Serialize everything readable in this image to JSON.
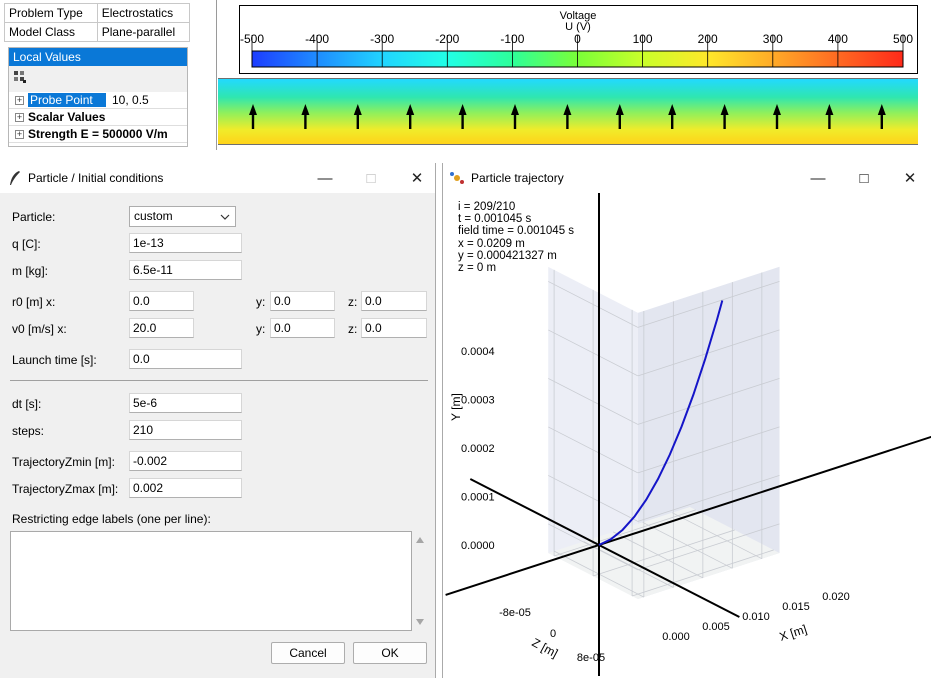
{
  "properties": [
    {
      "key": "Problem Type",
      "value": "Electrostatics"
    },
    {
      "key": "Model Class",
      "value": "Plane-parallel"
    }
  ],
  "local_values": {
    "title": "Local Values",
    "toolbar_icon": "grid-icon",
    "rows": [
      {
        "label": "Probe Point",
        "value": "10, 0.5"
      },
      {
        "label": "Scalar Values",
        "value": ""
      },
      {
        "label": "Strength E = 500000 V/m",
        "value": ""
      }
    ]
  },
  "colorbar": {
    "title": "Voltage",
    "subtitle": "U (V)",
    "ticks": [
      "-500",
      "-400",
      "-300",
      "-200",
      "-100",
      "0",
      "100",
      "200",
      "300",
      "400",
      "500"
    ],
    "colors": [
      "#1d3dff",
      "#1f8cff",
      "#21d4ff",
      "#22ffe6",
      "#2dff9a",
      "#7aff38",
      "#c9ff2a",
      "#ffe82a",
      "#ffab28",
      "#ff6a22",
      "#ff2a1a"
    ]
  },
  "field_strip": {
    "arrow_count": 13,
    "arrow_direction": "up"
  },
  "initial_conditions": {
    "title": "Particle / Initial conditions",
    "title_icon": "quill-icon",
    "particle_label": "Particle:",
    "particle_value": "custom",
    "q_label": "q [C]:",
    "q_value": "1e-13",
    "m_label": "m [kg]:",
    "m_value": "6.5e-11",
    "r0_label": "r0 [m]  x:",
    "r0_x": "0.0",
    "r0_y_label": "y:",
    "r0_y": "0.0",
    "r0_z_label": "z:",
    "r0_z": "0.0",
    "v0_label": "v0 [m/s] x:",
    "v0_x": "20.0",
    "v0_y_label": "y:",
    "v0_y": "0.0",
    "v0_z_label": "z:",
    "v0_z": "0.0",
    "launch_label": "Launch time [s]:",
    "launch_value": "0.0",
    "dt_label": "dt [s]:",
    "dt_value": "5e-6",
    "steps_label": "steps:",
    "steps_value": "210",
    "zmin_label": "TrajectoryZmin [m]:",
    "zmin_value": "-0.002",
    "zmax_label": "TrajectoryZmax [m]:",
    "zmax_value": "0.002",
    "edges_label": "Restricting edge labels (one per line):",
    "edges_value": "",
    "cancel_label": "Cancel",
    "ok_label": "OK"
  },
  "trajectory_window": {
    "title": "Particle trajectory",
    "title_icon": "particle-icon",
    "info": [
      "i = 209/210",
      "t = 0.001045 s",
      "field time = 0.001045 s",
      "x = 0.0209 m",
      "y = 0.000421327 m",
      "z = 0 m"
    ]
  },
  "chart_data": {
    "type": "line",
    "projection": "3d",
    "xlabel": "X [m]",
    "ylabel": "Y [m]",
    "zlabel": "Z [m]",
    "x_ticks": [
      "0.000",
      "0.005",
      "0.010",
      "0.015",
      "0.020"
    ],
    "y_ticks": [
      "0.0000",
      "0.0001",
      "0.0002",
      "0.0003",
      "0.0004"
    ],
    "z_ticks": [
      "-8e-05",
      "0",
      "8e-05"
    ],
    "xlim": [
      0,
      0.0209
    ],
    "ylim": [
      0,
      0.000421327
    ],
    "series": [
      {
        "color": "#1515c8",
        "x": [
          0,
          0.002,
          0.004,
          0.006,
          0.008,
          0.01,
          0.012,
          0.014,
          0.016,
          0.018,
          0.02,
          0.0209
        ],
        "y": [
          0,
          3.9e-06,
          1.54e-05,
          3.47e-05,
          6.17e-05,
          9.64e-05,
          0.0001388,
          0.0001889,
          0.0002467,
          0.0003123,
          0.0003855,
          0.000421327
        ],
        "z": [
          0,
          0,
          0,
          0,
          0,
          0,
          0,
          0,
          0,
          0,
          0,
          0
        ]
      }
    ]
  }
}
